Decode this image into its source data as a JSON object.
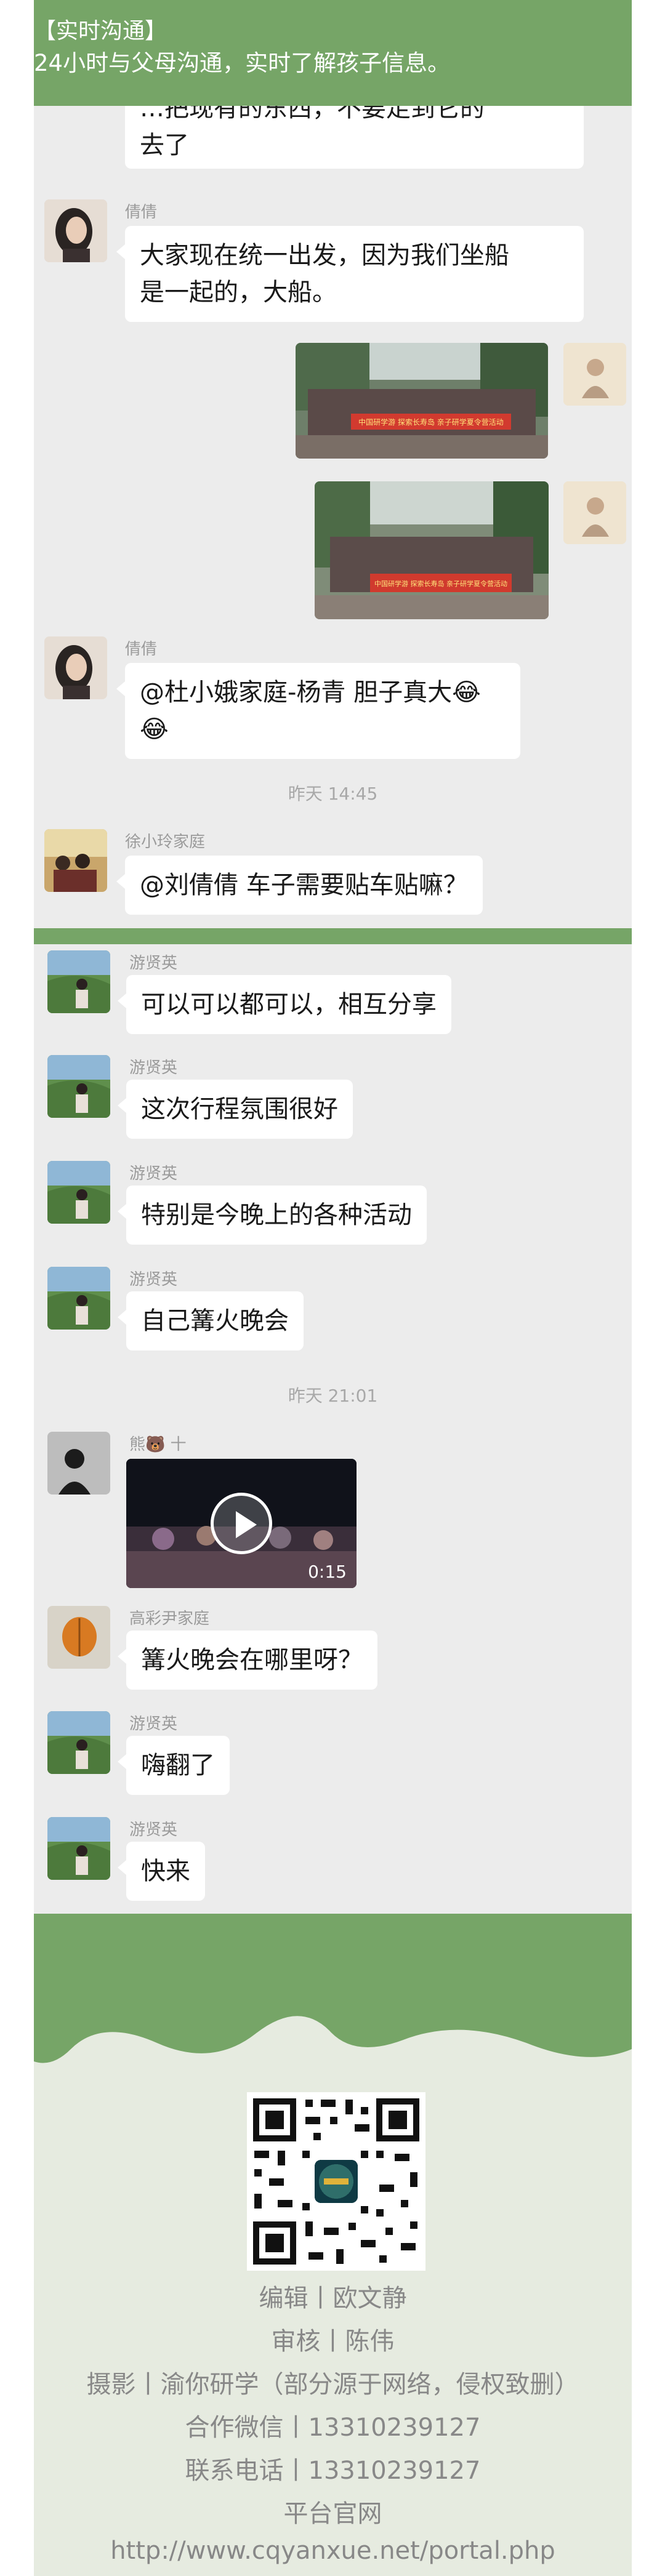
{
  "header": {
    "title": "【实时沟通】",
    "subtitle": "24小时与父母沟通，实时了解孩子信息。"
  },
  "chat1": {
    "partial_bubble": {
      "line1": "…把现有的东西，不要走到它的",
      "line2": "去了"
    },
    "m1": {
      "sender": "倩倩",
      "line1": "大家现在统一出发，因为我们坐船",
      "line2": "是一起的，大船。"
    },
    "m4": {
      "sender": "倩倩",
      "line1": "@杜小娥家庭-杨青  胆子真大",
      "emoji1": "😂",
      "emoji2": "😂"
    },
    "time1": "昨天 14:45",
    "m5": {
      "sender": "徐小玲家庭",
      "text": "@刘倩倩  车子需要贴车贴嘛？"
    },
    "photo1_banner": "中国研学游 探索长寿岛 亲子研学夏令营活动",
    "photo2_banner": "中国研学游 探索长寿岛 亲子研学夏令营活动"
  },
  "chat2": {
    "messages": [
      {
        "sender": "游贤英",
        "text": "可以可以都可以，相互分享"
      },
      {
        "sender": "游贤英",
        "text": "这次行程氛围很好"
      },
      {
        "sender": "游贤英",
        "text": "特别是今晚上的各种活动"
      },
      {
        "sender": "游贤英",
        "text": "自己篝火晚会"
      }
    ],
    "time2": "昨天 21:01",
    "video": {
      "sender": "熊🐻 十",
      "duration": "0:15"
    },
    "m_after": [
      {
        "sender": "高彩尹家庭",
        "text": "篝火晚会在哪里呀？"
      },
      {
        "sender": "游贤英",
        "text": "嗨翻了"
      },
      {
        "sender": "游贤英",
        "text": "快来"
      }
    ]
  },
  "footer": {
    "editor": "编辑丨欧文静",
    "reviewer": "审核丨陈伟",
    "photo": "摄影丨渝你研学（部分源于网络，侵权致删）",
    "wechat": "合作微信丨13310239127",
    "phone": "联系电话丨13310239127",
    "site_label": "平台官网",
    "url": "http://www.cqyanxue.net/portal.php"
  },
  "colors": {
    "brand_green": "#76a567",
    "chat_bg": "#ececec",
    "footer_bg": "#e6ebe0"
  }
}
